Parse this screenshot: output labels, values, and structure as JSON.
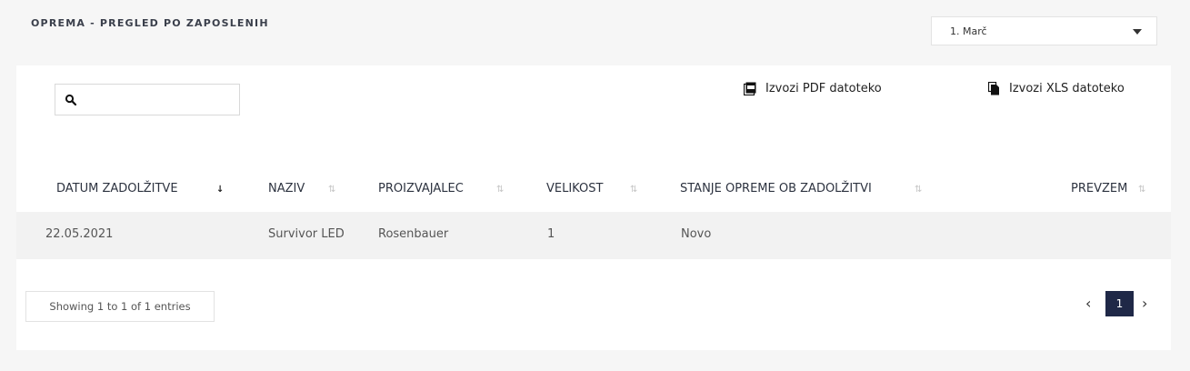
{
  "header": {
    "title": "OPREMA - PREGLED PO ZAPOSLENIH"
  },
  "month_select": {
    "value": "1. Marč"
  },
  "search": {
    "placeholder": ""
  },
  "exports": {
    "pdf_label": "Izvozi PDF datoteko",
    "xls_label": "Izvozi XLS datoteko"
  },
  "table": {
    "columns": [
      "DATUM ZADOLŽITVE",
      "NAZIV",
      "PROIZVAJALEC",
      "VELIKOST",
      "STANJE OPREME OB ZADOLŽITVI",
      "PREVZEM"
    ],
    "rows": [
      [
        "22.05.2021",
        "Survivor LED",
        "Rosenbauer",
        "1",
        "Novo",
        ""
      ]
    ]
  },
  "footer": {
    "info": "Showing 1 to 1 of 1 entries",
    "prev": "‹",
    "current_page": "1",
    "next": "›"
  }
}
